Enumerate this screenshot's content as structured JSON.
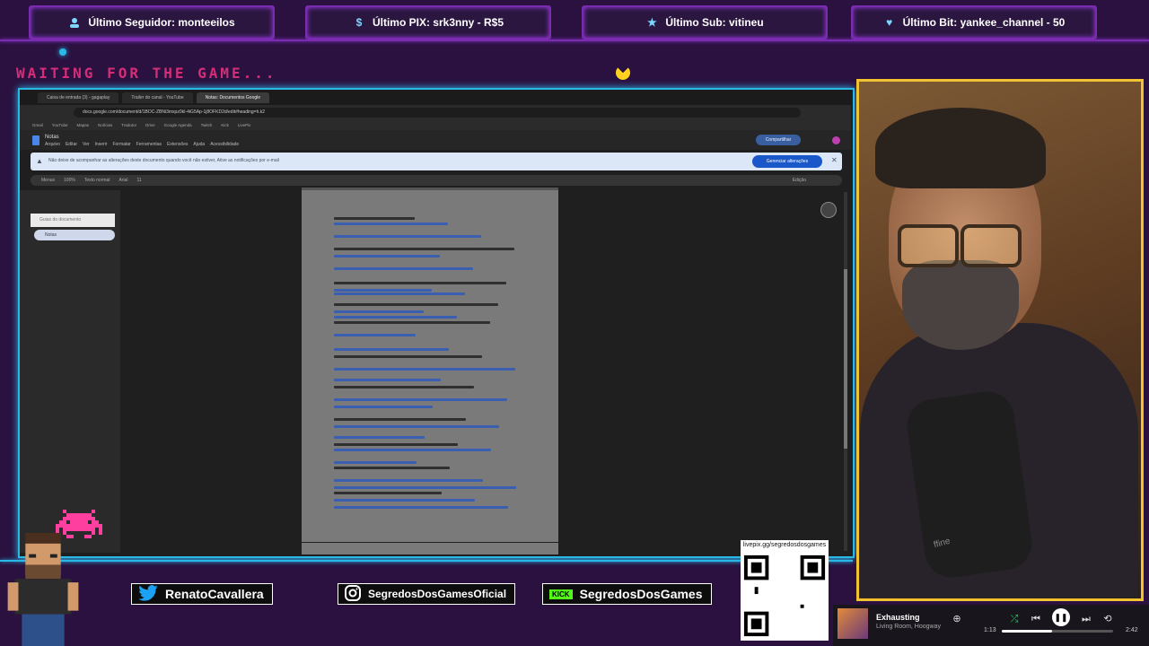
{
  "alerts": [
    {
      "icon": "user-icon",
      "text": "Último Seguidor: monteeilos"
    },
    {
      "icon": "dollar-icon",
      "text": "Último PIX: srk3nny - R$5"
    },
    {
      "icon": "star-icon",
      "text": "Último Sub: vitineu"
    },
    {
      "icon": "diamond-icon",
      "text": "Último Bit: yankee_channel - 50"
    }
  ],
  "waiting_text": "WAITING FOR THE GAME...",
  "browser": {
    "tabs": [
      "Caixa de entrada (3) - gagaplay",
      "Trailer do canal - YouTube",
      "Notas: Documentos Google"
    ],
    "url": "docs.google.com/document/d/1BOC-ZBNi3mxpz0kI-4iG5Ap-1j8OFKD2d/edit#heading=h.k2",
    "bookmarks": [
      "Gmail",
      "YouTube",
      "Mapas",
      "Notícias",
      "Tradutor",
      "Drive",
      "Google Agenda",
      "Twitch",
      "Kick",
      "LivePix"
    ],
    "doc_title": "Notas",
    "doc_menu": [
      "Arquivo",
      "Editar",
      "Ver",
      "Inserir",
      "Formatar",
      "Ferramentas",
      "Extensões",
      "Ajuda",
      "Acessibilidade"
    ],
    "share_label": "Compartilhar",
    "banner_text": "Não deixe de acompanhar as alterações deste documento quando você não estiver, Ative as notificações por e-mail",
    "banner_button": "Gerenciar alterações",
    "toolbar_items": [
      "Menus",
      "100%",
      "Texto normal",
      "Arial",
      "11",
      "Edição"
    ],
    "outline_header": "Guias do documento",
    "outline_item": "Notas"
  },
  "socials": [
    {
      "icon": "twitter-icon",
      "handle": "RenatoCavallera"
    },
    {
      "icon": "instagram-icon",
      "handle": "SegredosDosGamesOficial"
    },
    {
      "icon": "kick-icon",
      "handle": "SegredosDosGames",
      "badge": "KICK"
    }
  ],
  "qr_label": "livepix.gg/segredosdosgames",
  "music": {
    "track": "Exhausting",
    "artist": "Living Room, Hoogway",
    "elapsed": "1:13",
    "duration": "2:42",
    "progress": 0.45
  },
  "webcam_mic_brand": "ffine"
}
